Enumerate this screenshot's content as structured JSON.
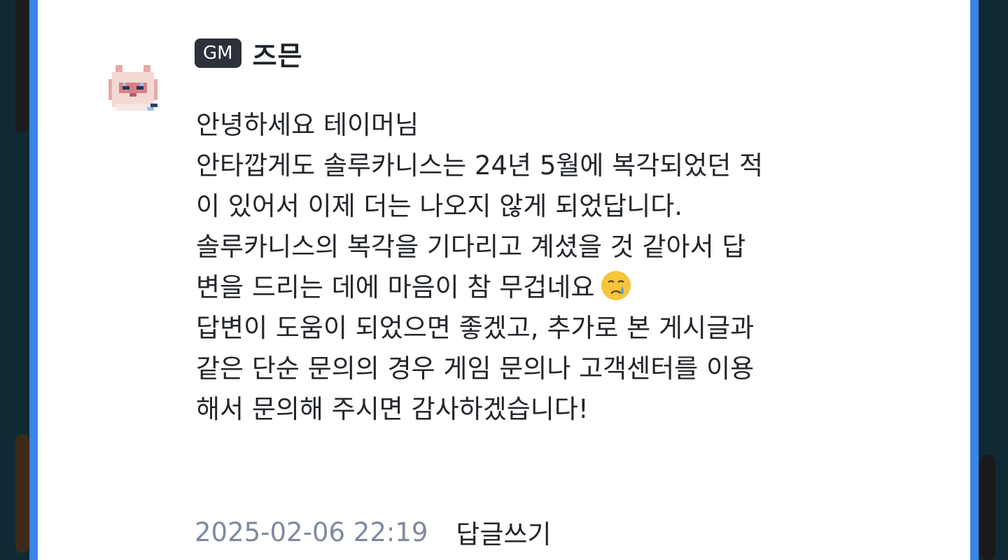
{
  "comment": {
    "badge": "GM",
    "author": "즈믄",
    "avatar_icon": "pixel-cat-icon",
    "message_lines": [
      "안녕하세요 테이머님",
      "안타깝게도 솔루카니스는 24년 5월에 복각되었던 적",
      "이 있어서 이제 더는 나오지 않게 되었답니다.",
      "솔루카니스의 복각을 기다리고 계셨을 것 같아서 답",
      "변을 드리는 데에 마음이 참 무겁네요",
      "답변이 도움이 되었으면 좋겠고, 추가로 본 게시글과",
      "같은 단순 문의의 경우 게임 문의나 고객센터를 이용",
      "해서 문의해 주시면 감사하겠습니다!"
    ],
    "emoji_icon": "crying-face-icon",
    "timestamp": "2025-02-06 22:19",
    "reply_label": "답글쓰기"
  },
  "colors": {
    "card_border": "#3a84e8",
    "badge_bg": "#2c313b",
    "timestamp": "#7d8aa0"
  }
}
